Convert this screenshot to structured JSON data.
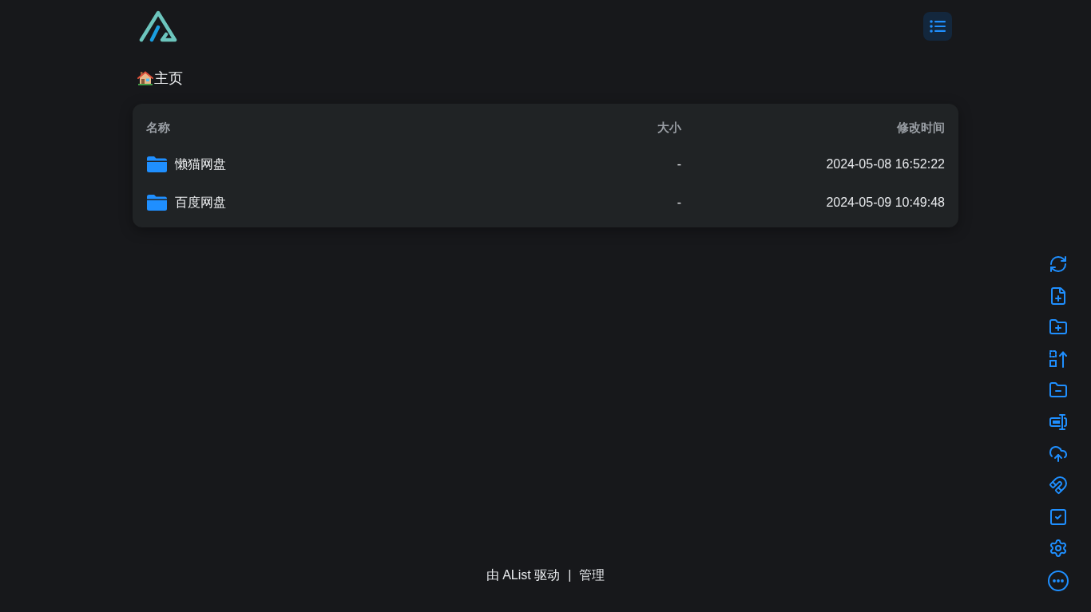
{
  "breadcrumb": {
    "label": "主页"
  },
  "table": {
    "columns": [
      "名称",
      "大小",
      "修改时间"
    ],
    "rows": [
      {
        "kind": "folder",
        "name": "懒猫网盘",
        "size": "-",
        "modified": "2024-05-08 16:52:22"
      },
      {
        "kind": "folder",
        "name": "百度网盘",
        "size": "-",
        "modified": "2024-05-09 10:49:48"
      }
    ]
  },
  "footer": {
    "powered_by": "由 AList 驱动",
    "separator": "|",
    "manage": "管理"
  }
}
